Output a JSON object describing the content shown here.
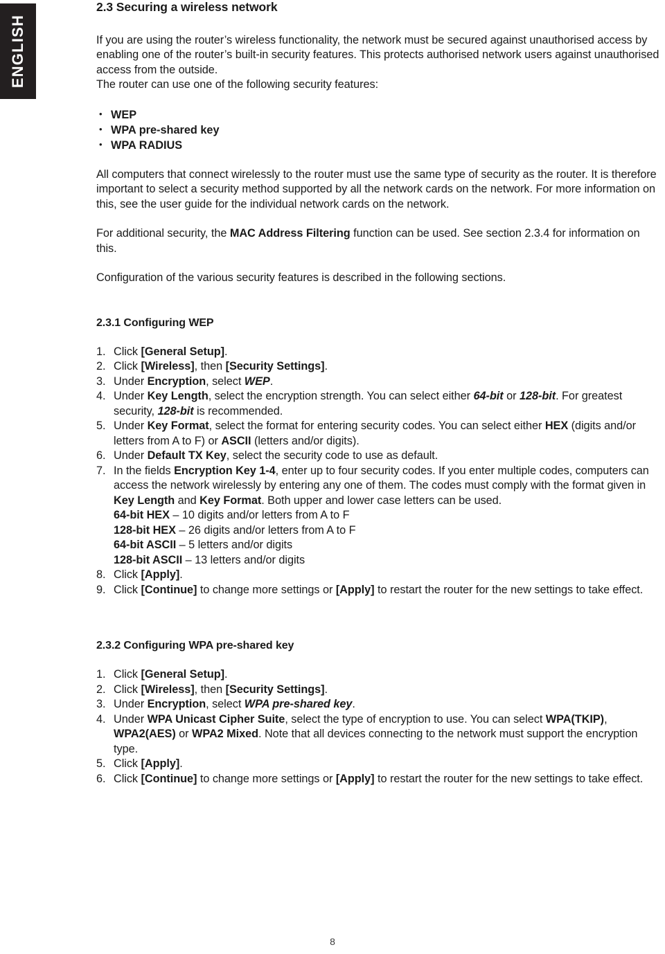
{
  "language_tab": {
    "label": "ENGLISH"
  },
  "page": {
    "number": "8"
  },
  "section": {
    "number": "2.3",
    "title": "Securing a wireless network",
    "heading_full": "2.3  Securing a wireless network",
    "intro_paragraph": "If you are using the router’s wireless functionality, the network must be secured against unauthorised access by enabling one of the router’s built-in security features. This protects authorised network users against unauthorised access from the outside.",
    "intro_paragraph_line2": "The router can use one of the following security features:",
    "security_features": [
      "WEP",
      "WPA pre-shared key",
      "WPA RADIUS"
    ],
    "paragraph_same_type": "All computers that connect wirelessly to the router must use the same type of security as the router. It is therefore important to select a security method supported by all the network cards on the network. For more information on this, see the user guide for the individual network cards on the network.",
    "paragraph_mac_pre": "For additional security, the ",
    "paragraph_mac_bold": "MAC Address Filtering",
    "paragraph_mac_post": " function can be used. See section 2.3.4 for information on this.",
    "paragraph_configuration": "Configuration of the various security features is described in the following sections."
  },
  "subsection_wep": {
    "number": "2.3.1",
    "title": "Configuring WEP",
    "heading_full": "2.3.1  Configuring WEP",
    "steps": [
      {
        "n": "1.",
        "parts": [
          {
            "t": "Click ",
            "s": "normal"
          },
          {
            "t": "[General Setup]",
            "s": "bold"
          },
          {
            "t": ".",
            "s": "normal"
          }
        ]
      },
      {
        "n": "2.",
        "parts": [
          {
            "t": "Click ",
            "s": "normal"
          },
          {
            "t": "[Wireless]",
            "s": "bold"
          },
          {
            "t": ", then ",
            "s": "normal"
          },
          {
            "t": "[Security Settings]",
            "s": "bold"
          },
          {
            "t": ".",
            "s": "normal"
          }
        ]
      },
      {
        "n": "3.",
        "parts": [
          {
            "t": "Under ",
            "s": "normal"
          },
          {
            "t": "Encryption",
            "s": "bold"
          },
          {
            "t": ", select ",
            "s": "normal"
          },
          {
            "t": "WEP",
            "s": "bolditalic"
          },
          {
            "t": ".",
            "s": "normal"
          }
        ]
      },
      {
        "n": "4.",
        "parts": [
          {
            "t": "Under ",
            "s": "normal"
          },
          {
            "t": "Key Length",
            "s": "bold"
          },
          {
            "t": ", select the encryption strength. You can select either ",
            "s": "normal"
          },
          {
            "t": "64-bit",
            "s": "bolditalic"
          },
          {
            "t": " or ",
            "s": "normal"
          },
          {
            "t": "128-bit",
            "s": "bolditalic"
          },
          {
            "t": ". For greatest security, ",
            "s": "normal"
          },
          {
            "t": "128-bit",
            "s": "bolditalic"
          },
          {
            "t": " is recommended.",
            "s": "normal"
          }
        ]
      },
      {
        "n": "5.",
        "parts": [
          {
            "t": "Under ",
            "s": "normal"
          },
          {
            "t": "Key Format",
            "s": "bold"
          },
          {
            "t": ", select the format for entering security codes. You can select either ",
            "s": "normal"
          },
          {
            "t": "HEX",
            "s": "bold"
          },
          {
            "t": " (digits and/or letters from A to F) or ",
            "s": "normal"
          },
          {
            "t": "ASCII",
            "s": "bold"
          },
          {
            "t": " (letters and/or digits).",
            "s": "normal"
          }
        ]
      },
      {
        "n": "6.",
        "parts": [
          {
            "t": "Under ",
            "s": "normal"
          },
          {
            "t": "Default TX Key",
            "s": "bold"
          },
          {
            "t": ", select the security code to use as default.",
            "s": "normal"
          }
        ]
      },
      {
        "n": "7.",
        "parts": [
          {
            "t": "In the fields ",
            "s": "normal"
          },
          {
            "t": "Encryption Key 1-4",
            "s": "bold"
          },
          {
            "t": ", enter up to four security codes. If you enter multiple codes, computers can access the network wirelessly by entering any one of them. The codes must comply with the format given in ",
            "s": "normal"
          },
          {
            "t": "Key Length",
            "s": "bold"
          },
          {
            "t": " and ",
            "s": "normal"
          },
          {
            "t": "Key Format",
            "s": "bold"
          },
          {
            "t": ". Both upper and lower case letters can be used.",
            "s": "normal"
          }
        ],
        "extra_lines": [
          [
            {
              "t": "64-bit HEX",
              "s": "bold"
            },
            {
              "t": " – 10 digits and/or letters from A to F",
              "s": "normal"
            }
          ],
          [
            {
              "t": "128-bit HEX",
              "s": "bold"
            },
            {
              "t": " – 26 digits and/or letters from A to F",
              "s": "normal"
            }
          ],
          [
            {
              "t": "64-bit ASCII",
              "s": "bold"
            },
            {
              "t": " – 5 letters and/or digits",
              "s": "normal"
            }
          ],
          [
            {
              "t": "128-bit ASCII",
              "s": "bold"
            },
            {
              "t": " – 13 letters and/or digits",
              "s": "normal"
            }
          ]
        ]
      },
      {
        "n": "8.",
        "parts": [
          {
            "t": "Click ",
            "s": "normal"
          },
          {
            "t": "[Apply]",
            "s": "bold"
          },
          {
            "t": ".",
            "s": "normal"
          }
        ]
      },
      {
        "n": "9.",
        "parts": [
          {
            "t": "Click ",
            "s": "normal"
          },
          {
            "t": "[Continue]",
            "s": "bold"
          },
          {
            "t": " to change more settings or ",
            "s": "normal"
          },
          {
            "t": "[Apply]",
            "s": "bold"
          },
          {
            "t": " to restart the router for the new settings to take effect.",
            "s": "normal"
          }
        ]
      }
    ]
  },
  "subsection_wpa": {
    "number": "2.3.2",
    "title": "Configuring WPA pre-shared key",
    "heading_full": "2.3.2  Configuring WPA pre-shared key",
    "steps": [
      {
        "n": "1.",
        "parts": [
          {
            "t": "Click ",
            "s": "normal"
          },
          {
            "t": "[General Setup]",
            "s": "bold"
          },
          {
            "t": ".",
            "s": "normal"
          }
        ]
      },
      {
        "n": "2.",
        "parts": [
          {
            "t": "Click ",
            "s": "normal"
          },
          {
            "t": "[Wireless]",
            "s": "bold"
          },
          {
            "t": ", then ",
            "s": "normal"
          },
          {
            "t": "[Security Settings]",
            "s": "bold"
          },
          {
            "t": ".",
            "s": "normal"
          }
        ]
      },
      {
        "n": "3.",
        "parts": [
          {
            "t": "Under ",
            "s": "normal"
          },
          {
            "t": "Encryption",
            "s": "bold"
          },
          {
            "t": ", select ",
            "s": "normal"
          },
          {
            "t": "WPA pre-shared key",
            "s": "bolditalic"
          },
          {
            "t": ".",
            "s": "normal"
          }
        ]
      },
      {
        "n": "4.",
        "parts": [
          {
            "t": "Under ",
            "s": "normal"
          },
          {
            "t": "WPA Unicast Cipher Suite",
            "s": "bold"
          },
          {
            "t": ", select the type of encryption to use. You can select ",
            "s": "normal"
          },
          {
            "t": "WPA(TKIP)",
            "s": "bold"
          },
          {
            "t": ", ",
            "s": "normal"
          },
          {
            "t": "WPA2(AES)",
            "s": "bold"
          },
          {
            "t": " or ",
            "s": "normal"
          },
          {
            "t": "WPA2 Mixed",
            "s": "bold"
          },
          {
            "t": ". Note that all devices connecting to the network must support the encryption type.",
            "s": "normal"
          }
        ]
      },
      {
        "n": "5.",
        "parts": [
          {
            "t": "Click ",
            "s": "normal"
          },
          {
            "t": "[Apply]",
            "s": "bold"
          },
          {
            "t": ".",
            "s": "normal"
          }
        ]
      },
      {
        "n": "6.",
        "parts": [
          {
            "t": "Click ",
            "s": "normal"
          },
          {
            "t": "[Continue]",
            "s": "bold"
          },
          {
            "t": " to change more settings or ",
            "s": "normal"
          },
          {
            "t": "[Apply]",
            "s": "bold"
          },
          {
            "t": " to restart the router for the new settings to take effect.",
            "s": "normal"
          }
        ]
      }
    ]
  },
  "colors": {
    "tab_background": "#231f20",
    "tab_text": "#ffffff",
    "body_text": "#1a1a1a",
    "page_background": "#ffffff"
  }
}
